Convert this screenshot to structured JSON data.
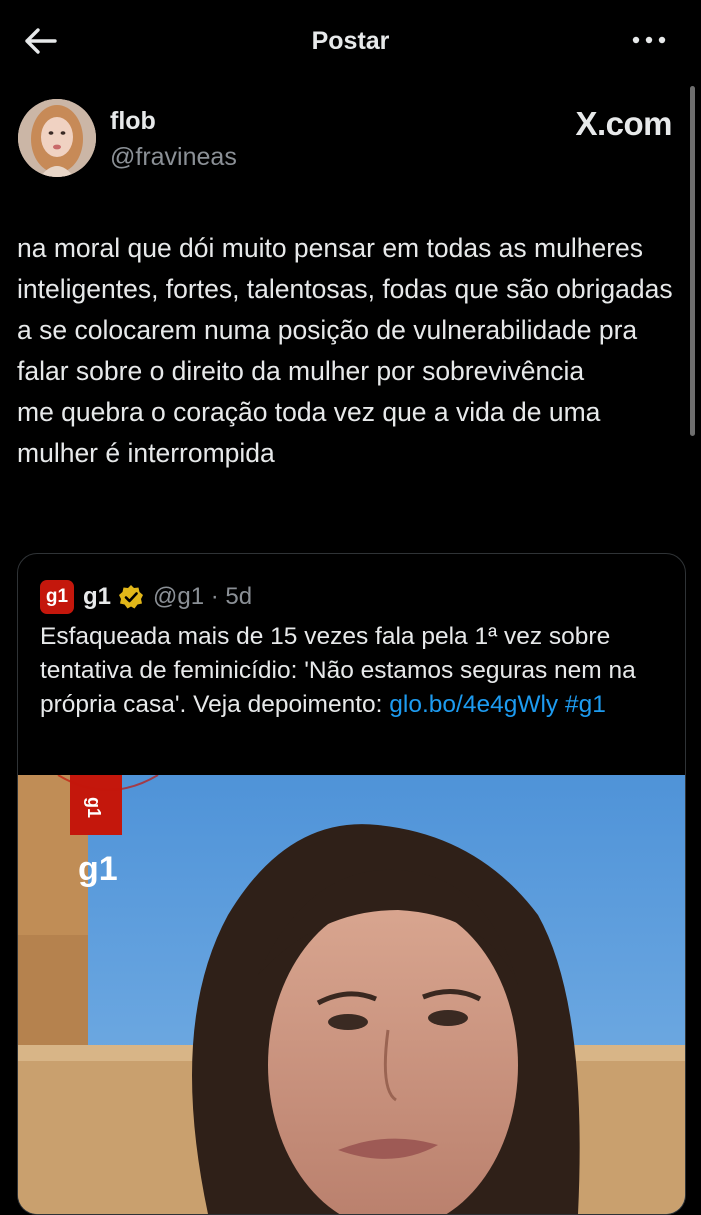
{
  "header": {
    "title": "Postar",
    "back_icon": "arrow-left-icon",
    "more_icon": "more-dots-icon"
  },
  "author": {
    "name": "flob",
    "handle": "@fravineas",
    "watermark": "X.com"
  },
  "tweet": {
    "paragraphs": [
      "na moral que dói muito pensar em todas as mulheres inteligentes, fortes, talentosas, fodas que são obrigadas a se colocarem numa posição de vulnerabilidade pra falar sobre o direito da mulher por sobrevivência",
      "me quebra o coração toda vez que a vida de uma mulher é interrompida"
    ]
  },
  "quote": {
    "logo_text": "g1",
    "name": "g1",
    "handle_time": "@g1 · 5d",
    "text": "Esfaqueada mais de 15 vezes fala pela 1ª vez sobre tentativa de feminicídio: 'Não estamos seguras nem na própria casa'. Veja depoimento: ",
    "link": "glo.bo/4e4gWly",
    "hashtag": "#g1",
    "media_overlay_logo": "g1",
    "media_tag_text": "g1"
  },
  "colors": {
    "background": "#000000",
    "text": "#e7e9ea",
    "secondary": "#8b9096",
    "link": "#1d9bf0",
    "brand_g1": "#c4170c",
    "verified": "#e2b719"
  }
}
